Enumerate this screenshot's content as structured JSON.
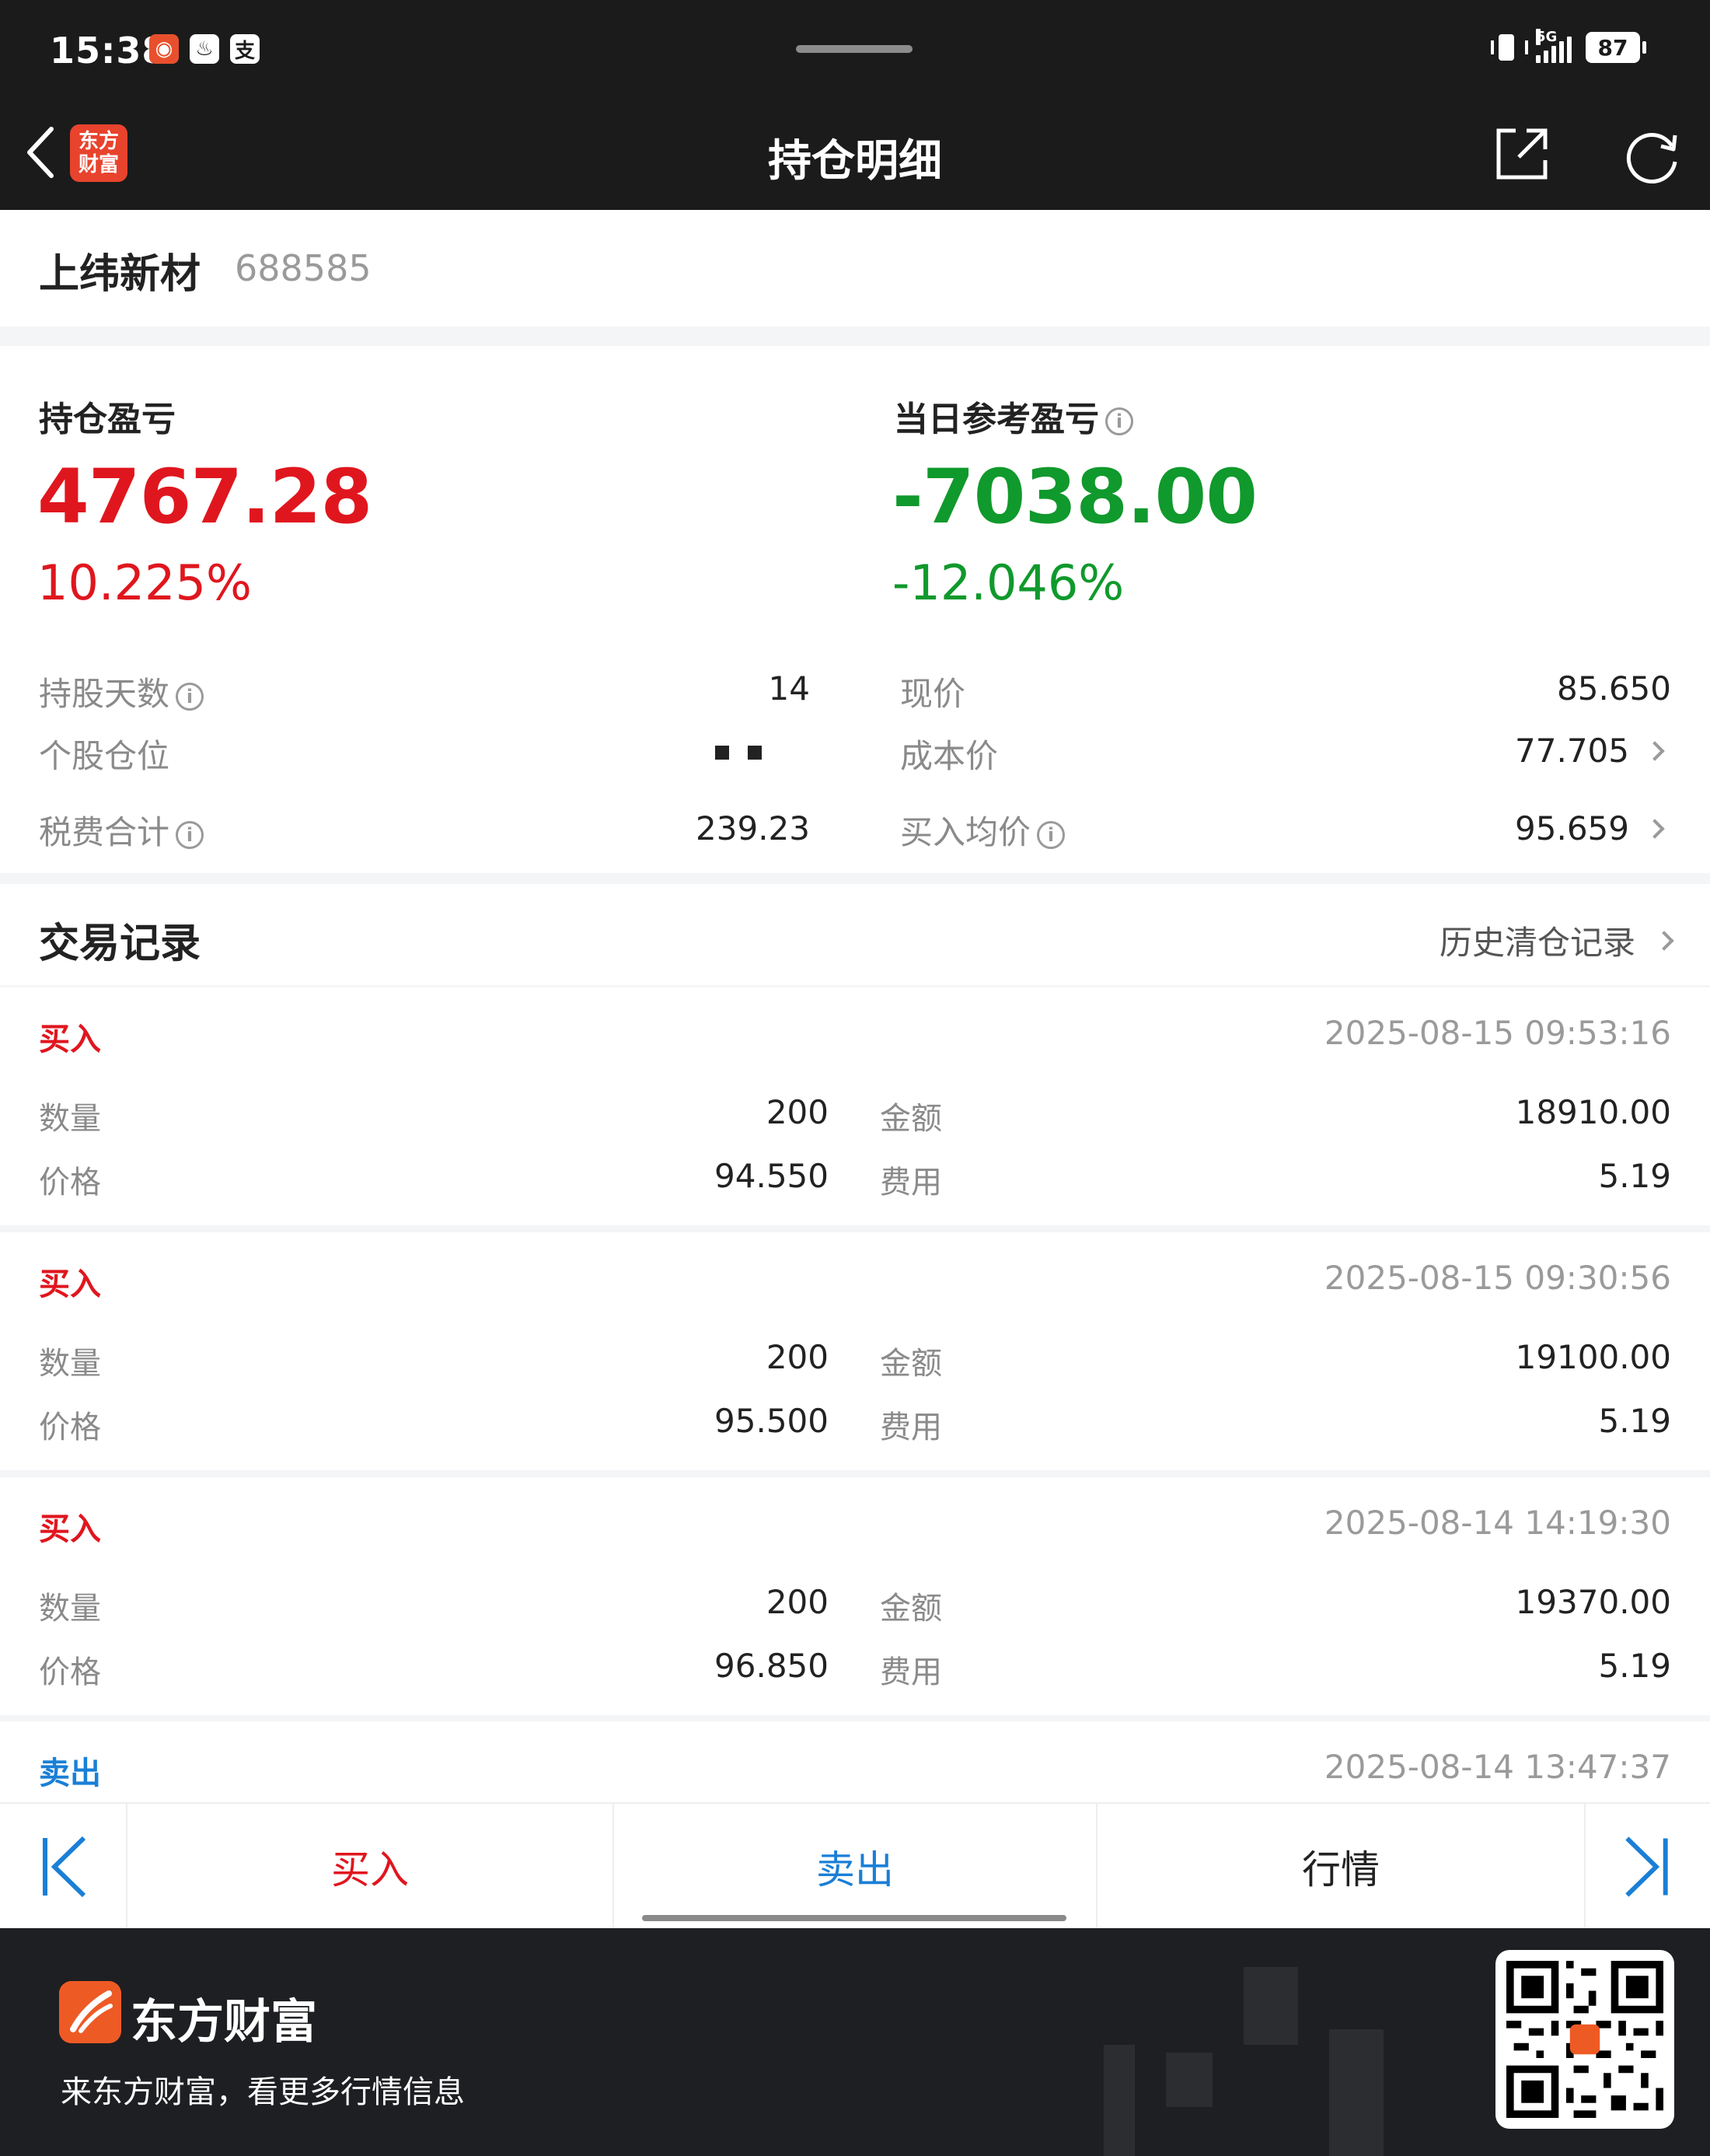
{
  "status_bar": {
    "time": "15:38",
    "network": "5G",
    "battery": "87"
  },
  "nav": {
    "logo_text": "东方财富",
    "title": "持仓明细"
  },
  "stock": {
    "name": "上纬新材",
    "code": "688585"
  },
  "summary": {
    "position_pnl_label": "持仓盈亏",
    "position_pnl_value": "4767.28",
    "position_pnl_pct": "10.225%",
    "daily_pnl_label": "当日参考盈亏",
    "daily_pnl_value": "-7038.00",
    "daily_pnl_pct": "-12.046%",
    "rows_left": [
      {
        "label": "持股天数",
        "value": "14"
      },
      {
        "label": "个股仓位",
        "value": ""
      },
      {
        "label": "税费合计",
        "value": "239.23"
      }
    ],
    "rows_right": [
      {
        "label": "现价",
        "value": "85.650"
      },
      {
        "label": "成本价",
        "value": "77.705"
      },
      {
        "label": "买入均价",
        "value": "95.659"
      }
    ]
  },
  "records": {
    "title": "交易记录",
    "history_link": "历史清仓记录",
    "labels": {
      "qty": "数量",
      "amount": "金额",
      "price": "价格",
      "fee": "费用"
    },
    "items": [
      {
        "type": "买入",
        "time": "2025-08-15 09:53:16",
        "qty": "200",
        "amount": "18910.00",
        "price": "94.550",
        "fee": "5.19"
      },
      {
        "type": "买入",
        "time": "2025-08-15 09:30:56",
        "qty": "200",
        "amount": "19100.00",
        "price": "95.500",
        "fee": "5.19"
      },
      {
        "type": "买入",
        "time": "2025-08-14 14:19:30",
        "qty": "200",
        "amount": "19370.00",
        "price": "96.850",
        "fee": "5.19"
      },
      {
        "type": "卖出",
        "time": "2025-08-14 13:47:37"
      }
    ]
  },
  "actions": {
    "buy": "买入",
    "sell": "卖出",
    "quote": "行情"
  },
  "banner": {
    "brand": "东方财富",
    "slogan": "来东方财富，看更多行情信息"
  },
  "colors": {
    "gain": "#e0161e",
    "loss": "#10992c",
    "sell_blue": "#1a7fd6",
    "brand_orange": "#ee5a24"
  }
}
